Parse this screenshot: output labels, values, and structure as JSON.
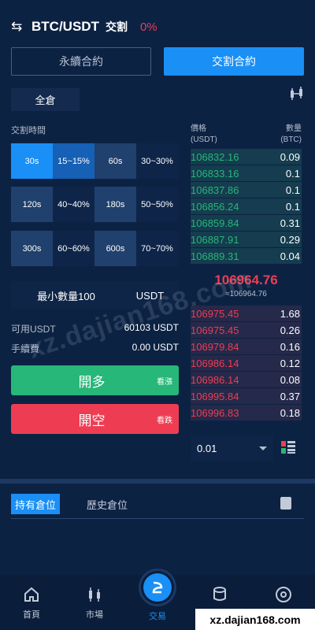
{
  "header": {
    "pair": "BTC/USDT",
    "mode": "交割",
    "change": "0%"
  },
  "tabs": {
    "perpetual": "永續合約",
    "delivery": "交割合約"
  },
  "full_position": "全倉",
  "delivery_time_label": "交割時間",
  "time_options": [
    {
      "time": "30s",
      "rate": "15~15%"
    },
    {
      "time": "60s",
      "rate": "30~30%"
    },
    {
      "time": "120s",
      "rate": "40~40%"
    },
    {
      "time": "180s",
      "rate": "50~50%"
    },
    {
      "time": "300s",
      "rate": "60~60%"
    },
    {
      "time": "600s",
      "rate": "70~70%"
    }
  ],
  "min_qty": {
    "label": "最小數量100",
    "unit": "USDT"
  },
  "available": {
    "label": "可用USDT",
    "value": "60103 USDT"
  },
  "fee": {
    "label": "手續費",
    "value": "0.00 USDT"
  },
  "buttons": {
    "long": "開多",
    "long_sub": "看漲",
    "short": "開空",
    "short_sub": "看跌"
  },
  "orderbook": {
    "price_label": "價格",
    "price_unit": "(USDT)",
    "qty_label": "數量",
    "qty_unit": "(BTC)",
    "bids": [
      {
        "p": "106832.16",
        "q": "0.09"
      },
      {
        "p": "106833.16",
        "q": "0.1"
      },
      {
        "p": "106837.86",
        "q": "0.1"
      },
      {
        "p": "106856.24",
        "q": "0.1"
      },
      {
        "p": "106859.84",
        "q": "0.31"
      },
      {
        "p": "106887.91",
        "q": "0.29"
      },
      {
        "p": "106889.31",
        "q": "0.04"
      }
    ],
    "mid_price": "106964.76",
    "mid_sub": "≈106964.76",
    "asks": [
      {
        "p": "106975.45",
        "q": "1.68"
      },
      {
        "p": "106975.45",
        "q": "0.26"
      },
      {
        "p": "106979.84",
        "q": "0.16"
      },
      {
        "p": "106986.14",
        "q": "0.12"
      },
      {
        "p": "106986.14",
        "q": "0.08"
      },
      {
        "p": "106995.84",
        "q": "0.37"
      },
      {
        "p": "106996.83",
        "q": "0.18"
      }
    ],
    "depth": "0.01"
  },
  "position_tabs": {
    "holding": "持有倉位",
    "history": "歷史倉位"
  },
  "nav": {
    "home": "首頁",
    "market": "市場",
    "trade": "交易"
  },
  "watermark": "xz.dajian168.com",
  "watermark_corner": "xz.dajian168.com"
}
